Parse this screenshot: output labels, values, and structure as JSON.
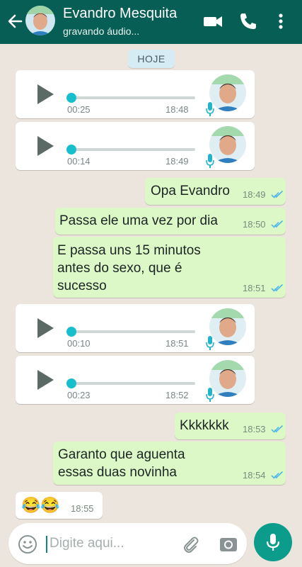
{
  "header": {
    "contact_name": "Evandro Mesquita",
    "status": "gravando áudio...",
    "icons": [
      "back-arrow-icon",
      "video-call-icon",
      "phone-icon",
      "more-options-icon"
    ]
  },
  "chat": {
    "date_label": "HOJE",
    "messages": [
      {
        "type": "audio",
        "direction": "in",
        "duration": "00:25",
        "time": "18:48"
      },
      {
        "type": "audio",
        "direction": "in",
        "duration": "00:14",
        "time": "18:49"
      },
      {
        "type": "text",
        "direction": "out",
        "lines": [
          "Opa Evandro"
        ],
        "time": "18:49",
        "read": true
      },
      {
        "type": "text",
        "direction": "out",
        "lines": [
          "Passa ele uma vez por dia"
        ],
        "time": "18:50",
        "read": true
      },
      {
        "type": "text",
        "direction": "out",
        "lines": [
          "E passa uns 15 minutos",
          "antes do sexo, que é",
          "sucesso"
        ],
        "time": "18:51",
        "read": true
      },
      {
        "type": "audio",
        "direction": "in",
        "duration": "00:10",
        "time": "18:51"
      },
      {
        "type": "audio",
        "direction": "in",
        "duration": "00:23",
        "time": "18:52"
      },
      {
        "type": "text",
        "direction": "out",
        "lines": [
          "Kkkkkkk"
        ],
        "time": "18:53",
        "read": true
      },
      {
        "type": "text",
        "direction": "out",
        "lines": [
          "Garanto que aguenta",
          "essas duas novinha"
        ],
        "time": "18:54",
        "read": true
      },
      {
        "type": "text",
        "direction": "in",
        "lines": [
          "😂😂"
        ],
        "time": "18:55"
      }
    ]
  },
  "footer": {
    "placeholder": "Digite aqui..."
  },
  "colors": {
    "header": "#075e54",
    "outgoing_bubble": "#dcf8c6",
    "incoming_bubble": "#ffffff",
    "chat_background": "#ece5dd",
    "audio_accent": "#17bfcd",
    "read_ticks": "#4fb6ec",
    "mic_button": "#0b9c8c"
  }
}
